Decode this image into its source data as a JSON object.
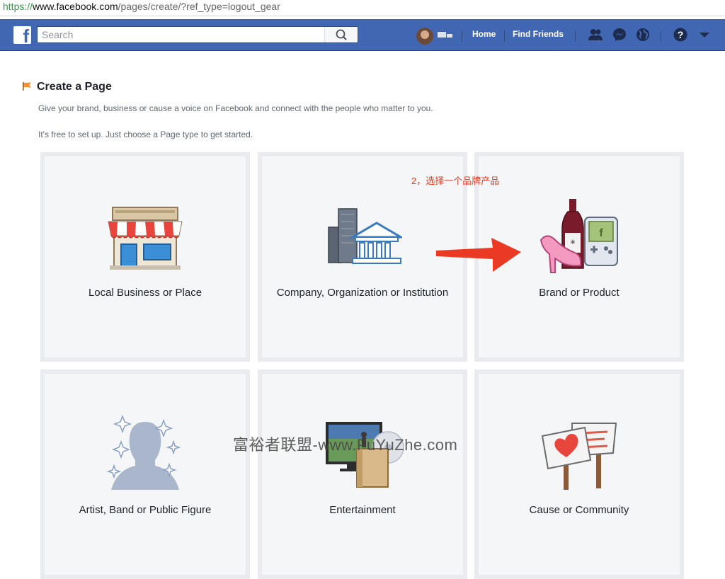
{
  "browser": {
    "url_scheme": "https://",
    "url_host": "www.facebook.com",
    "url_path": "/pages/create/?ref_type=logout_gear"
  },
  "topbar": {
    "logo": "f",
    "search_placeholder": "Search",
    "home_label": "Home",
    "find_friends_label": "Find Friends",
    "icons": [
      "friend-requests-icon",
      "messenger-icon",
      "globe-notifications-icon",
      "help-icon",
      "dropdown-arrow-icon"
    ]
  },
  "page": {
    "title": "Create a Page",
    "description": "Give your brand, business or cause a voice on Facebook and connect with the people who matter to you.",
    "subdescription": "It's free to set up. Just choose a Page type to get started."
  },
  "cards": [
    {
      "label": "Local Business or Place",
      "icon": "storefront-icon"
    },
    {
      "label": "Company, Organization or Institution",
      "icon": "buildings-icon"
    },
    {
      "label": "Brand or Product",
      "icon": "brand-products-icon"
    },
    {
      "label": "Artist, Band or Public Figure",
      "icon": "artist-silhouette-icon"
    },
    {
      "label": "Entertainment",
      "icon": "entertainment-icon"
    },
    {
      "label": "Cause or Community",
      "icon": "cause-signs-icon"
    }
  ],
  "annotation": "2，选择一个品牌产品",
  "watermark": "富裕者联盟-www.FuYuZhe.com",
  "colors": {
    "fb_blue": "#4267b2",
    "annotation_red": "#e03a20",
    "card_background": "#f5f6f7",
    "card_border": "#e9ebee"
  }
}
